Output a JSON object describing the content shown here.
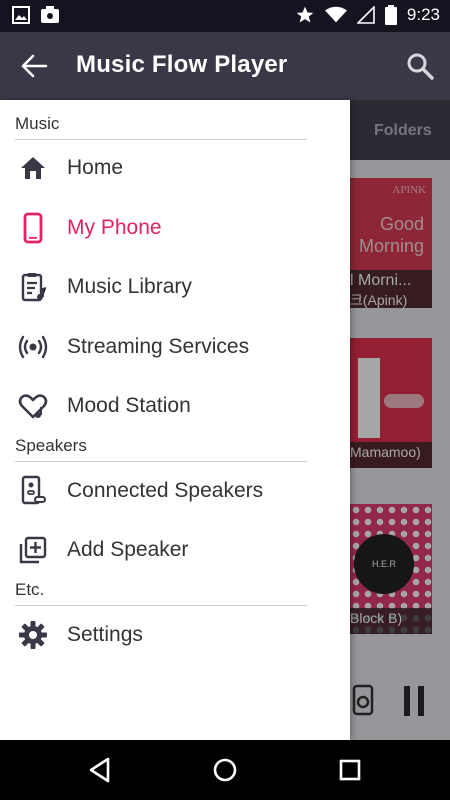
{
  "status": {
    "time": "9:23"
  },
  "appbar": {
    "title": "Music Flow Player"
  },
  "background": {
    "tab_folders": "Folders",
    "cards": [
      {
        "line1": "l Morni...",
        "line2": "크(Apink)",
        "art_text1": "APINK",
        "art_text2": "Good",
        "art_text3": "Morning"
      },
      {
        "line1": "Mamamoo)"
      },
      {
        "line1": "Block B)",
        "art_text1": "H.E.R"
      }
    ]
  },
  "drawer": {
    "sections": [
      {
        "title": "Music",
        "items": [
          {
            "label": "Home",
            "icon": "home-icon"
          },
          {
            "label": "My Phone",
            "icon": "phone-icon",
            "active": true
          },
          {
            "label": "Music Library",
            "icon": "music-library-icon"
          },
          {
            "label": "Streaming Services",
            "icon": "streaming-icon"
          },
          {
            "label": "Mood Station",
            "icon": "mood-heart-icon"
          }
        ]
      },
      {
        "title": "Speakers",
        "items": [
          {
            "label": "Connected Speakers",
            "icon": "speaker-link-icon"
          },
          {
            "label": "Add Speaker",
            "icon": "add-speaker-icon"
          }
        ]
      },
      {
        "title": "Etc.",
        "items": [
          {
            "label": "Settings",
            "icon": "gear-icon"
          }
        ]
      }
    ]
  },
  "colors": {
    "accent": "#e0245e",
    "appbar": "#3b3747",
    "statusbar": "#151320"
  }
}
